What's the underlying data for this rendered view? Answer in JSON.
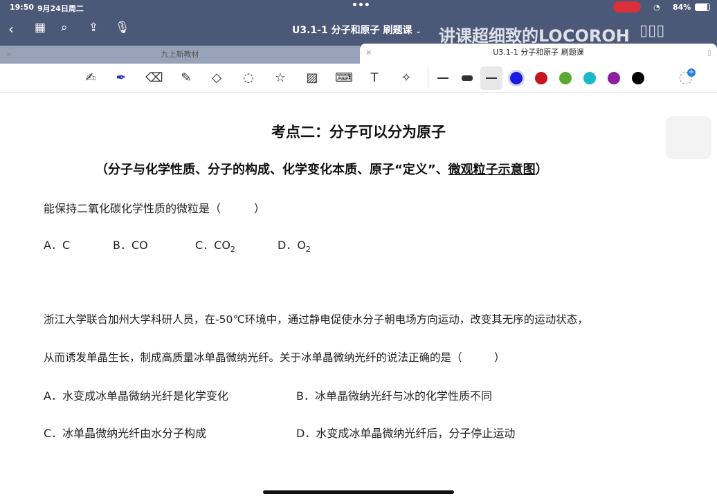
{
  "status": {
    "time": "19:50",
    "date": "9月24日周二",
    "battery": "84%"
  },
  "header": {
    "title": "U3.1-1 分子和原子 刷题课",
    "chevron": "⌄",
    "watermark": "讲课超细致的LOCOROH",
    "logo": "bilibili"
  },
  "tabs": [
    {
      "label": "九上新教材",
      "close": "×"
    },
    {
      "label": "U3.1-1 分子和原子 刷题课",
      "close": "×"
    }
  ],
  "toolbar": {
    "colors": [
      "#1a1ae0",
      "#c8141e",
      "#5aa832",
      "#1ab8c8",
      "#8c1ea0",
      "#000000",
      "#ffffff"
    ],
    "selected_color": "#1a1ae0"
  },
  "document": {
    "heading": "考点二：分子可以分为原子",
    "subheading_main": "（分子与化学性质、分子的构成、化学变化本质、原子“定义”、",
    "subheading_underlined": "微观粒子示意图",
    "subheading_end": "）",
    "q1": {
      "stem": "能保持二氧化碳化学性质的微粒是（　　　）",
      "options": {
        "a": "A．C",
        "b": "B．CO",
        "c": "C．CO",
        "c_sub": "2",
        "d": "D．O",
        "d_sub": "2"
      }
    },
    "q2": {
      "stem1": "浙江大学联合加州大学科研人员，在-50℃环境中，通过静电促使水分子朝电场方向运动，改变其无序的运动状态，",
      "stem2": "从而诱发单晶生长，制成高质量冰单晶微纳光纤。关于冰单晶微纳光纤的说法正确的是（　　　）",
      "options": [
        "A．水变成冰单晶微纳光纤是化学变化",
        "B．冰单晶微纳光纤与冰的化学性质不同",
        "C．冰单晶微纳光纤由水分子构成",
        "D．水变成冰单晶微纳光纤后，分子停止运动"
      ]
    }
  }
}
